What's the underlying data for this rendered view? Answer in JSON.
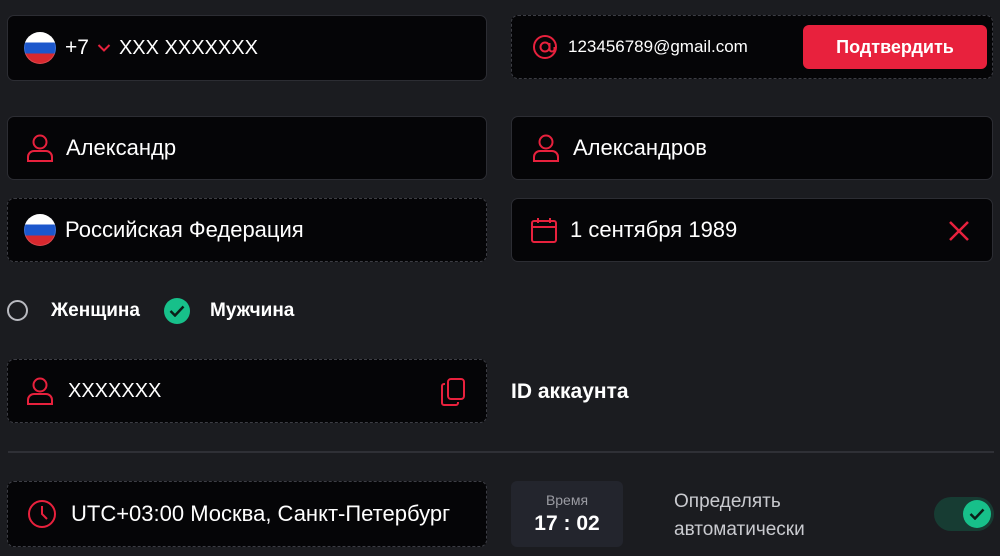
{
  "phone": {
    "flag_icon": "russia-flag-icon",
    "code": "+7",
    "number": "XXX XXXXXXX"
  },
  "email": {
    "icon": "at-icon",
    "value": "123456789@gmail.com",
    "confirm_label": "Подтвердить"
  },
  "first_name": {
    "icon": "user-icon",
    "value": "Александр"
  },
  "last_name": {
    "icon": "user-icon",
    "value": "Александров"
  },
  "country": {
    "flag_icon": "russia-flag-icon",
    "value": "Российская Федерация"
  },
  "birthdate": {
    "icon": "calendar-icon",
    "value": "1 сентября 1989",
    "clear_icon": "close-icon"
  },
  "gender": {
    "options": [
      {
        "label": "Женщина",
        "selected": false
      },
      {
        "label": "Мужчина",
        "selected": true
      }
    ]
  },
  "account": {
    "icon": "user-icon",
    "value": "XXXXXXX",
    "copy_icon": "copy-icon",
    "label": "ID аккаунта"
  },
  "timezone": {
    "icon": "clock-icon",
    "value": "UTC+03:00 Москва, Санкт-Петербург"
  },
  "time": {
    "label": "Время",
    "value": "17 : 02"
  },
  "auto_detect": {
    "label_line1": "Определять",
    "label_line2": "автоматически",
    "enabled": true
  },
  "colors": {
    "accent": "#e8213d",
    "success": "#17c08a",
    "field_bg": "#050507",
    "page_bg": "#1b1c20"
  }
}
